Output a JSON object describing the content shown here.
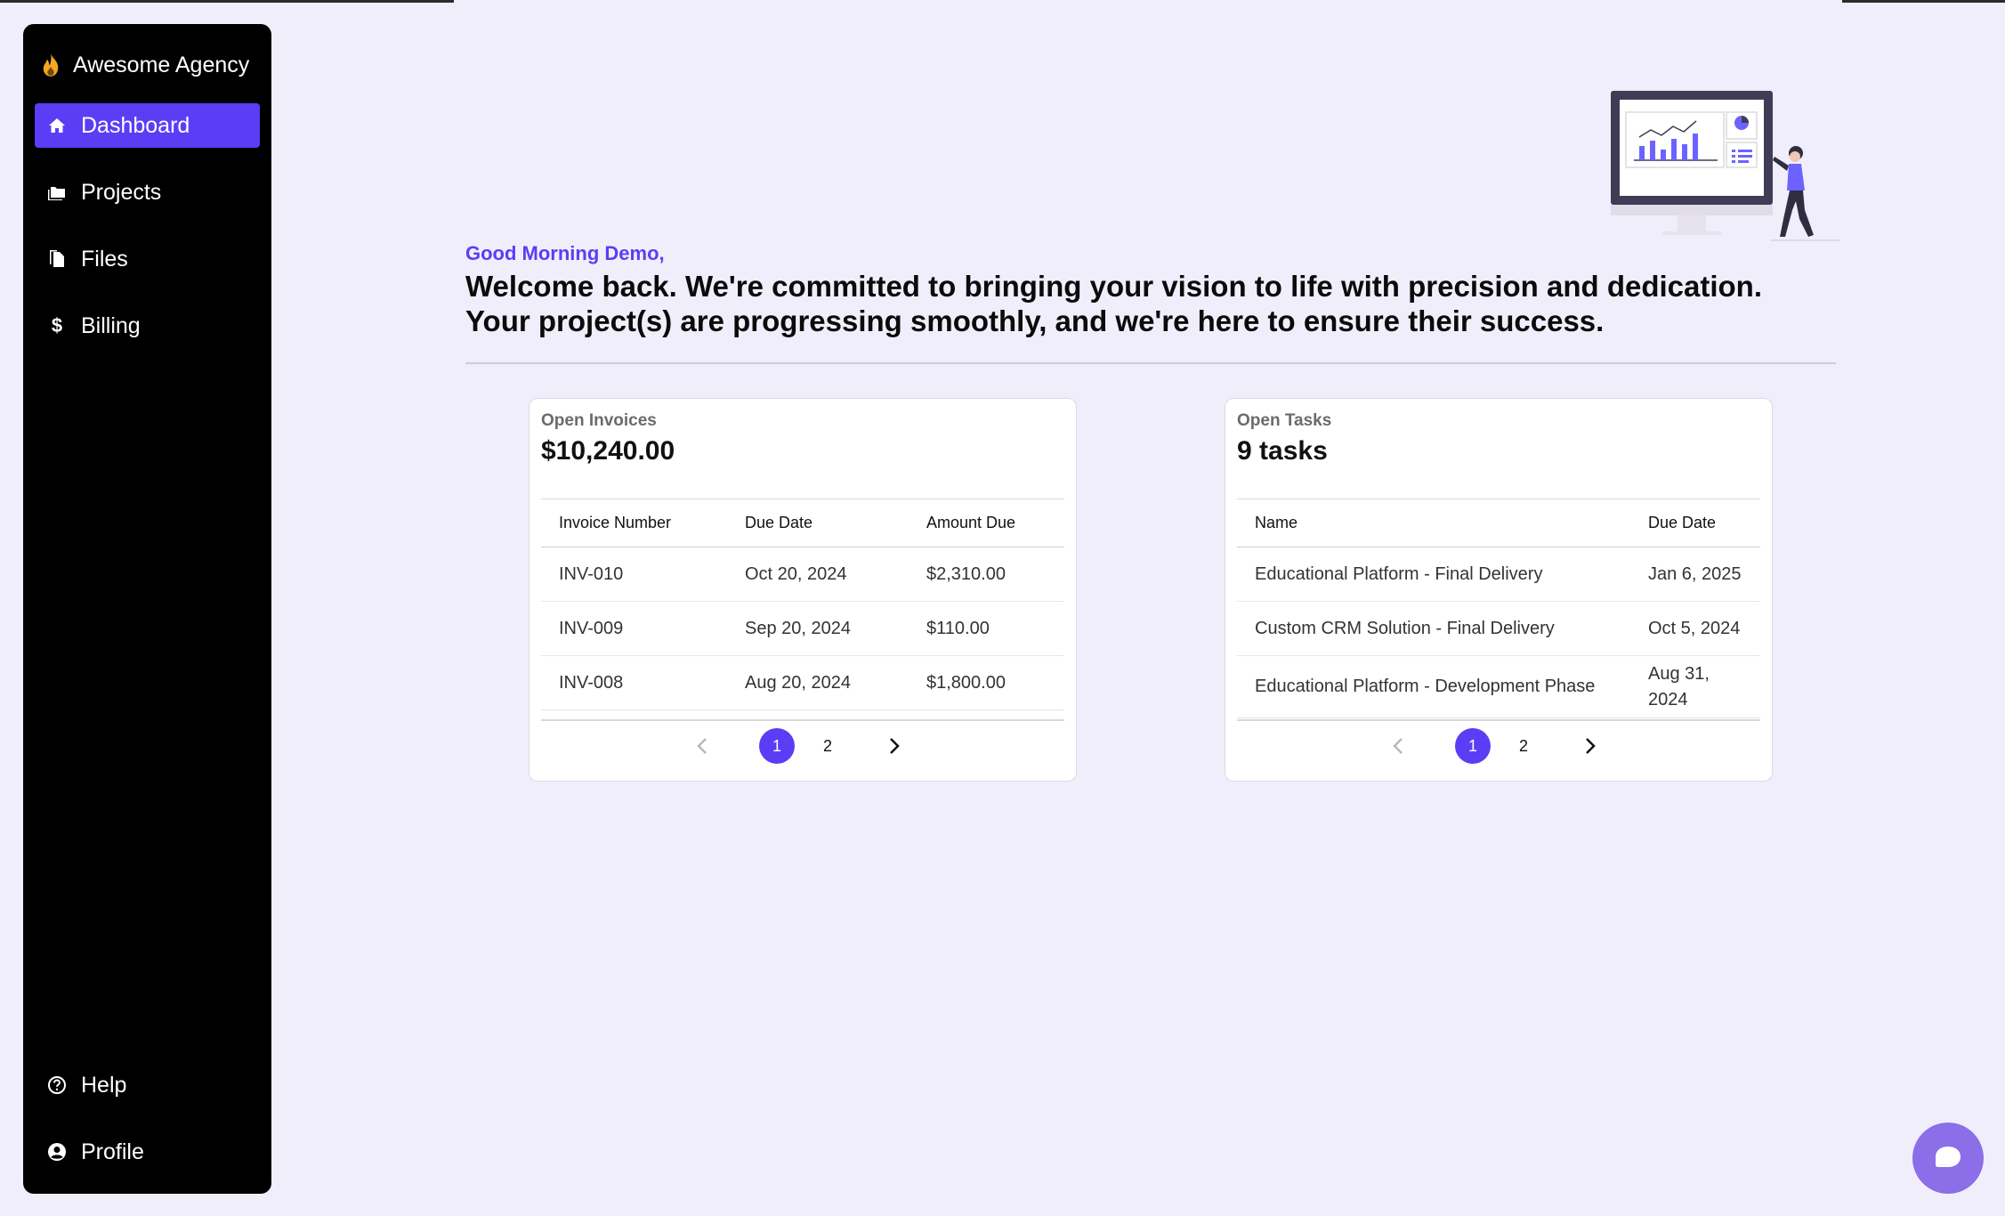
{
  "sidebar": {
    "brand": "Awesome Agency",
    "items": [
      {
        "label": "Dashboard",
        "icon": "home-icon",
        "active": true
      },
      {
        "label": "Projects",
        "icon": "folders-icon"
      },
      {
        "label": "Files",
        "icon": "files-icon"
      },
      {
        "label": "Billing",
        "icon": "dollar-icon"
      }
    ],
    "bottom_items": [
      {
        "label": "Help",
        "icon": "help-circle-icon"
      },
      {
        "label": "Profile",
        "icon": "user-circle-icon"
      }
    ]
  },
  "header": {
    "greeting": "Good Morning Demo,",
    "welcome_line1": "Welcome back. We're committed to bringing your vision to life with precision and dedication.",
    "welcome_line2": "Your project(s) are progressing smoothly, and we're here to ensure their success."
  },
  "invoices": {
    "label": "Open Invoices",
    "total": "$10,240.00",
    "columns": [
      "Invoice Number",
      "Due Date",
      "Amount Due"
    ],
    "rows": [
      [
        "INV-010",
        "Oct 20, 2024",
        "$2,310.00"
      ],
      [
        "INV-009",
        "Sep 20, 2024",
        "$110.00"
      ],
      [
        "INV-008",
        "Aug 20, 2024",
        "$1,800.00"
      ]
    ],
    "pages": [
      "1",
      "2"
    ],
    "current_page": "1"
  },
  "tasks": {
    "label": "Open Tasks",
    "total": "9 tasks",
    "columns": [
      "Name",
      "Due Date"
    ],
    "rows": [
      [
        "Educational Platform - Final Delivery",
        "Jan 6, 2025"
      ],
      [
        "Custom CRM Solution - Final Delivery",
        "Oct 5, 2024"
      ],
      [
        "Educational Platform - Development Phase",
        "Aug 31, 2024"
      ]
    ],
    "pages": [
      "1",
      "2"
    ],
    "current_page": "1"
  },
  "colors": {
    "accent": "#5b3df5",
    "background": "#f1eefc",
    "sidebar": "#000000",
    "brand_flame": "#f5a623",
    "chat_button": "#8b6ee8"
  },
  "chat": {
    "icon": "chat-bubble-icon"
  }
}
